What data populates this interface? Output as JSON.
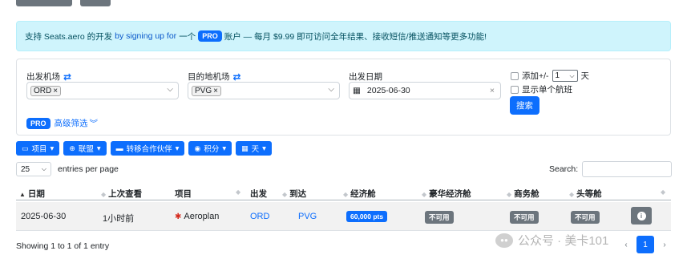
{
  "banner": {
    "prefix": "支持 Seats.aero 的开发",
    "link": "by signing up for",
    "middle": "一个",
    "pro": "PRO",
    "suffix": "账户 — 每月 $9.99 即可访问全年结果、接收短信/推送通知等更多功能!"
  },
  "search": {
    "origin_label": "出发机场",
    "origin_tag": "ORD",
    "dest_label": "目的地机场",
    "dest_tag": "PVG",
    "date_label": "出发日期",
    "date_value": "2025-06-30",
    "add_days_label": "添加+/-",
    "add_days_value": "1",
    "add_days_unit": "天",
    "single_flight_label": "显示单个航班",
    "submit": "搜索",
    "pro": "PRO",
    "advanced": "高级筛选"
  },
  "filters": [
    {
      "icon": "ticket-icon",
      "label": "项目"
    },
    {
      "icon": "globe-icon",
      "label": "联盟"
    },
    {
      "icon": "card-icon",
      "label": "转移合作伙伴"
    },
    {
      "icon": "coins-icon",
      "label": "积分"
    },
    {
      "icon": "calendar-icon",
      "label": "天"
    }
  ],
  "table_controls": {
    "page_size": "25",
    "entries_label": "entries per page",
    "search_label": "Search:"
  },
  "table": {
    "columns": [
      "日期",
      "上次查看",
      "项目",
      "出发",
      "到达",
      "经济舱",
      "豪华经济舱",
      "商务舱",
      "头等舱"
    ],
    "rows": [
      {
        "date": "2025-06-30",
        "last_seen": "1小时前",
        "program": "Aeroplan",
        "origin": "ORD",
        "destination": "PVG",
        "economy": "60,000 pts",
        "premium": "不可用",
        "business": "不可用",
        "first": "不可用"
      }
    ]
  },
  "footer": {
    "showing": "Showing 1 to 1 of 1 entry",
    "page": "1",
    "watermark": "公众号 · 美卡101"
  },
  "colors": {
    "primary": "#0d6efd",
    "secondary": "#6c757d",
    "info_bg": "#cff4fc"
  }
}
